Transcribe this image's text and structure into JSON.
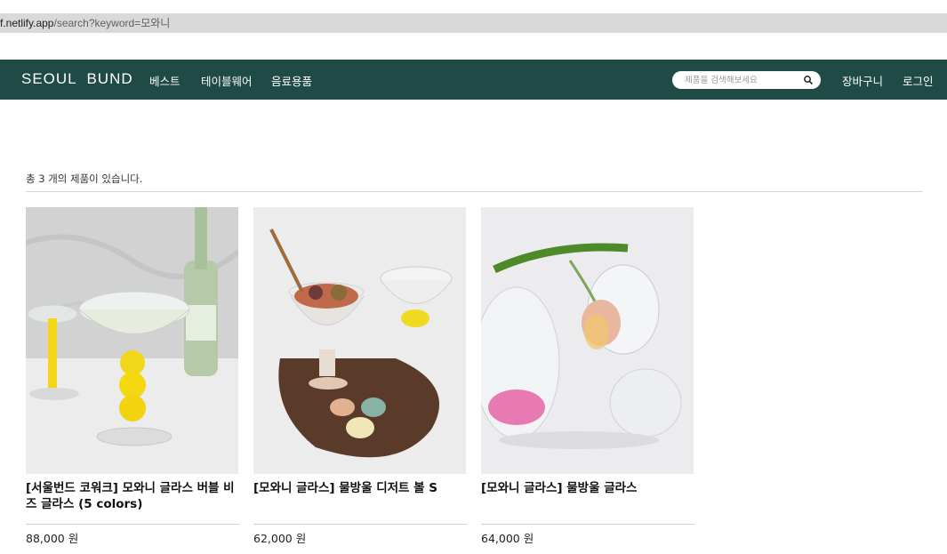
{
  "browser": {
    "url_host": "f.netlify.app",
    "url_path": "/search?keyword=모와니"
  },
  "header": {
    "logo": "SEOUL  BUND",
    "nav": [
      "베스트",
      "테이블웨어",
      "음료용품"
    ],
    "search_placeholder": "제품을 검색해보세요",
    "cart": "장바구니",
    "login": "로그인",
    "brand_color": "#1f4a46"
  },
  "results": {
    "count_text": "총 3 개의 제품이 있습니다.",
    "products": [
      {
        "title": "[서울번드 코워크] 모와니 글라스 버블 비즈 글라스 (5 colors)",
        "price": "88,000 원",
        "image": "yellow-bubble-coupe-glass"
      },
      {
        "title": "[모와니 글라스] 물방울 디저트 볼 S",
        "price": "62,000 원",
        "image": "dessert-bowl-with-sweets"
      },
      {
        "title": "[모와니 글라스] 물방울 글라스",
        "price": "64,000 원",
        "image": "glass-with-tulip"
      }
    ]
  }
}
